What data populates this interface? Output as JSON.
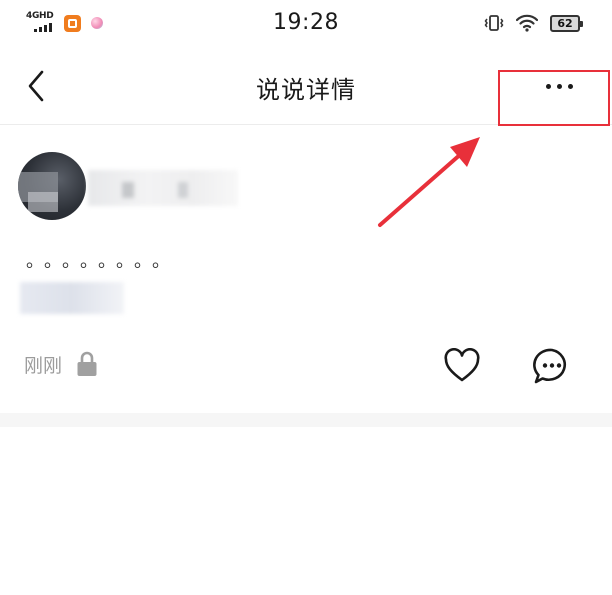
{
  "status_bar": {
    "network": "4GHD",
    "time": "19:28",
    "battery": "62",
    "icons": {
      "app1": "orange-app-icon",
      "app2": "pink-dot-icon",
      "vibrate": "vibrate-icon",
      "wifi": "wifi-icon"
    }
  },
  "nav": {
    "title": "说说详情",
    "back_icon": "back-chevron-icon",
    "more_icon": "more-dots-icon"
  },
  "post": {
    "avatar_icon": "avatar",
    "content": "。。。。。。。。",
    "time": "刚刚",
    "privacy_icon": "lock-icon",
    "like_icon": "heart-icon",
    "comment_icon": "comment-icon"
  },
  "annotation": {
    "highlight_color": "#e8303a",
    "target": "more-button"
  }
}
